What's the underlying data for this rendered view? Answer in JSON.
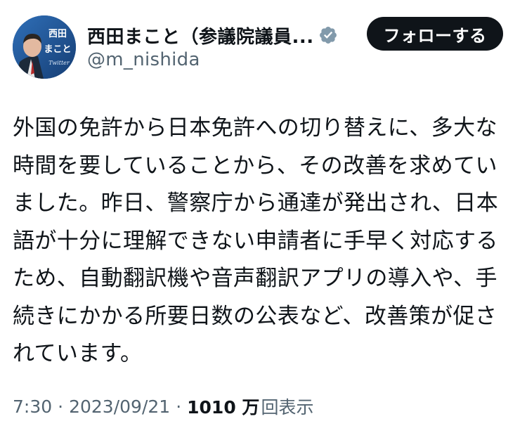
{
  "author": {
    "display_name": "西田まこと（参議院議員...",
    "handle": "@m_nishida",
    "avatar_text_line1": "西田",
    "avatar_text_line2": "まこと",
    "avatar_text_line3": "Twitter",
    "verified_icon": "verified-badge-icon",
    "verified_color": "#829aab"
  },
  "follow_button": {
    "label": "フォローする"
  },
  "tweet": {
    "text": "外国の免許から日本免許への切り替えに、多大な時間を要していることから、その改善を求めていました。昨日、警察庁から通達が発出され、日本語が十分に理解できない申請者に手早く対応するため、自動翻訳機や音声翻訳アプリの導入や、手続きにかかる所要日数の公表など、改善策が促されています。"
  },
  "meta": {
    "time": "7:30",
    "separator": "·",
    "date": "2023/09/21",
    "views_count": "1010 万",
    "views_label": "回表示"
  },
  "colors": {
    "text_primary": "#0f1419",
    "text_secondary": "#536471",
    "button_bg": "#0f1419",
    "button_text": "#ffffff"
  }
}
